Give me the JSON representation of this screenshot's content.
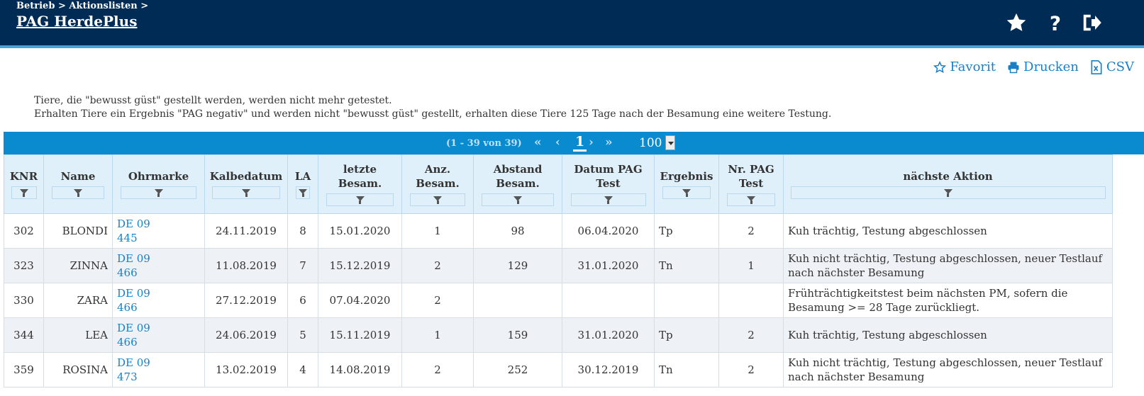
{
  "header": {
    "breadcrumb": "Betrieb > Aktionslisten >",
    "title": "PAG HerdePlus",
    "icons": [
      "star-icon",
      "help-icon",
      "logout-icon"
    ]
  },
  "actions": {
    "favorit": "Favorit",
    "drucken": "Drucken",
    "csv": "CSV"
  },
  "info": {
    "line1": "Tiere, die \"bewusst güst\" gestellt werden, werden nicht mehr getestet.",
    "line2": "Erhalten Tiere ein Ergebnis \"PAG negativ\" und werden nicht \"bewusst güst\" gestellt, erhalten diese Tiere 125 Tage nach der Besamung eine weitere Testung."
  },
  "pager": {
    "count": "(1 - 39 von 39)",
    "page": "1",
    "page_size": "100"
  },
  "table": {
    "headers": {
      "knr": "KNR",
      "name": "Name",
      "ohrmarke": "Ohrmarke",
      "kalbedatum": "Kalbedatum",
      "la": "LA",
      "letzte_besam": "letzte Besam.",
      "anz_besam": "Anz. Besam.",
      "abstand_besam": "Abstand Besam.",
      "datum_pag": "Datum PAG Test",
      "ergebnis": "Ergebnis",
      "nr_pag": "Nr. PAG Test",
      "naechste_aktion": "nächste Aktion"
    },
    "rows": [
      {
        "knr": "302",
        "name": "BLONDI",
        "ohr1": "DE 09",
        "ohr2": "445",
        "kalbe": "24.11.2019",
        "la": "8",
        "letzte": "15.01.2020",
        "anz": "1",
        "abstand": "98",
        "datum": "06.04.2020",
        "ergebnis": "Tp",
        "nr": "2",
        "aktion": "Kuh trächtig, Testung abgeschlossen"
      },
      {
        "knr": "323",
        "name": "ZINNA",
        "ohr1": "DE 09",
        "ohr2": "466",
        "kalbe": "11.08.2019",
        "la": "7",
        "letzte": "15.12.2019",
        "anz": "2",
        "abstand": "129",
        "datum": "31.01.2020",
        "ergebnis": "Tn",
        "nr": "1",
        "aktion": "Kuh nicht trächtig, Testung abgeschlossen, neuer Testlauf nach nächster Besamung"
      },
      {
        "knr": "330",
        "name": "ZARA",
        "ohr1": "DE 09",
        "ohr2": "466",
        "kalbe": "27.12.2019",
        "la": "6",
        "letzte": "07.04.2020",
        "anz": "2",
        "abstand": "",
        "datum": "",
        "ergebnis": "",
        "nr": "",
        "aktion": "Frühträchtigkeitstest beim nächsten PM, sofern die Besamung >= 28 Tage zurückliegt."
      },
      {
        "knr": "344",
        "name": "LEA",
        "ohr1": "DE 09",
        "ohr2": "466",
        "kalbe": "24.06.2019",
        "la": "5",
        "letzte": "15.11.2019",
        "anz": "1",
        "abstand": "159",
        "datum": "31.01.2020",
        "ergebnis": "Tp",
        "nr": "2",
        "aktion": "Kuh trächtig, Testung abgeschlossen"
      },
      {
        "knr": "359",
        "name": "ROSINA",
        "ohr1": "DE 09",
        "ohr2": "473",
        "kalbe": "13.02.2019",
        "la": "4",
        "letzte": "14.08.2019",
        "anz": "2",
        "abstand": "252",
        "datum": "30.12.2019",
        "ergebnis": "Tn",
        "nr": "2",
        "aktion": "Kuh nicht trächtig, Testung abgeschlossen, neuer Testlauf nach nächster Besamung"
      }
    ]
  },
  "colors": {
    "header_bg": "#002b55",
    "pager_bg": "#0a8bd0",
    "link": "#1a7fc4",
    "table_header_bg": "#dff0fa"
  }
}
